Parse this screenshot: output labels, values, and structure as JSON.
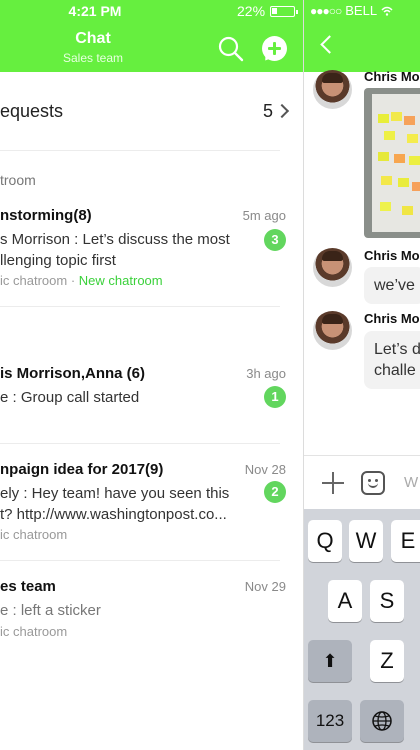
{
  "left_header": {
    "time": "4:21 PM",
    "battery": "22%",
    "title": "Chat",
    "subtitle": "Sales team"
  },
  "requests": {
    "label": "equests",
    "count": "5"
  },
  "section_label": "troom",
  "chats": [
    {
      "title": "nstorming(8)",
      "time": "5m ago",
      "message": "s Morrison : Let’s discuss the most llenging topic first",
      "meta": "ic chatroom",
      "meta_separator": "·",
      "meta_extra": "New chatroom",
      "badge": "3"
    },
    {
      "title": "is Morrison,Anna (6)",
      "time": "3h ago",
      "message": "e : Group call started",
      "badge": "1"
    },
    {
      "title": "npaign idea for 2017(9)",
      "time": "Nov 28",
      "message": "ely : Hey team! have you seen this t? http://www.washingtonpost.co...",
      "meta": "ic chatroom",
      "badge": "2"
    },
    {
      "title": "es team",
      "time": "Nov 29",
      "message": "e : left a sticker",
      "meta": "ic chatroom"
    }
  ],
  "right_header": {
    "signal": "●●●○○",
    "carrier": "BELL",
    "wifi_icon": "wifi-icon"
  },
  "conversation": [
    {
      "sender": "Chris Mor",
      "type": "photo"
    },
    {
      "sender": "Chris Mor",
      "text": "we’ve"
    },
    {
      "sender": "Chris Mor",
      "text": "Let’s d challe"
    }
  ],
  "input": {
    "hint": "W"
  },
  "keyboard": {
    "row1": [
      "Q",
      "W",
      "E"
    ],
    "row2": [
      "A",
      "S"
    ],
    "row3": [
      "Z"
    ],
    "shift": "⬆",
    "numbers": "123",
    "globe": "🌐"
  },
  "colors": {
    "brand": "#66ef3f",
    "badge": "#62d65e",
    "new_chatroom": "#3bd13b"
  }
}
